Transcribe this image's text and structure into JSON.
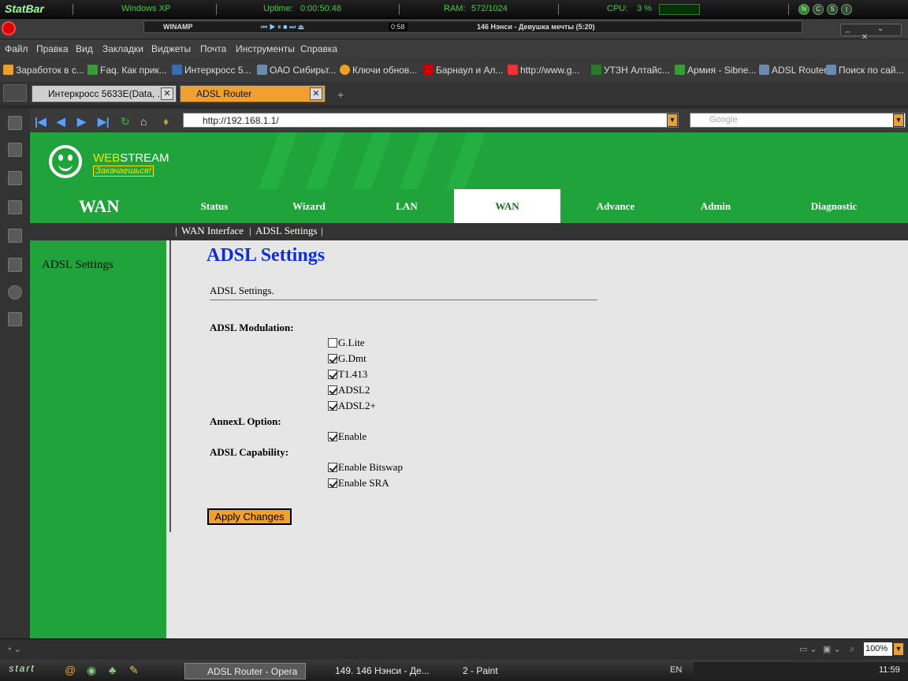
{
  "statbar": {
    "logo": "StatBar",
    "os": "Windows XP",
    "uptime_label": "Uptime:",
    "uptime": "0:00:50:48",
    "ram_label": "RAM:",
    "ram": "572/1024",
    "cpu_label": "CPU:",
    "cpu": "3 %"
  },
  "winamp": {
    "title": "WINAMP",
    "time": "0:58",
    "track": "146 Нэнси - Девушка мечты (5:20)"
  },
  "menu": [
    "Файл",
    "Правка",
    "Вид",
    "Закладки",
    "Виджеты",
    "Почта",
    "Инструменты",
    "Справка"
  ],
  "bookmarks": [
    "Заработок в с...",
    "Faq. Как прик...",
    "Интеркросс 5...",
    "ОАО Сибирьт...",
    "Ключи обнов...",
    "Барнаул и Ал...",
    "http://www.g...",
    "УТЗН Алтайс...",
    "Армия - Sibne...",
    "ADSL Router",
    "Поиск по сай..."
  ],
  "tabs": [
    {
      "label": "Интеркросс 5633E(Data, ...",
      "close": "✕"
    },
    {
      "label": "ADSL Router",
      "close": "✕"
    }
  ],
  "address": {
    "url": "http://192.168.1.1/",
    "search_placeholder": "Google"
  },
  "page": {
    "brand_web": "WEB",
    "brand_stream": "STREAM",
    "slogan": "Закачаешься!",
    "section": "WAN",
    "nav": [
      "Status",
      "Wizard",
      "LAN",
      "WAN",
      "Advance",
      "Admin",
      "Diagnostic"
    ],
    "subnav": [
      "|",
      "WAN Interface",
      "|",
      "ADSL Settings",
      "|"
    ],
    "left_item": "ADSL Settings",
    "title": "ADSL Settings",
    "description": "ADSL Settings.",
    "modulation_label": "ADSL Modulation:",
    "modulation": [
      {
        "label": "G.Lite",
        "checked": false
      },
      {
        "label": "G.Dmt",
        "checked": true
      },
      {
        "label": "T1.413",
        "checked": true
      },
      {
        "label": "ADSL2",
        "checked": true
      },
      {
        "label": "ADSL2+",
        "checked": true
      }
    ],
    "annexl_label": "AnnexL Option:",
    "annexl": [
      {
        "label": "Enable",
        "checked": true
      }
    ],
    "capability_label": "ADSL Capability:",
    "capability": [
      {
        "label": "Enable Bitswap",
        "checked": true
      },
      {
        "label": "Enable SRA",
        "checked": true
      }
    ],
    "apply": "Apply Changes"
  },
  "status": {
    "zoom": "100%"
  },
  "taskbar": {
    "start": "start",
    "items": [
      "ADSL Router - Opera",
      "149. 146 Нэнси - Де...",
      "2 - Paint"
    ],
    "lang": "EN",
    "clock": "11:59"
  }
}
